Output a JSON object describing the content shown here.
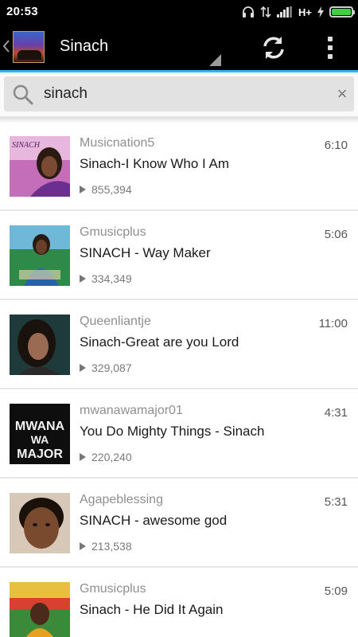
{
  "status_bar": {
    "time": "20:53",
    "network": "H+"
  },
  "action_bar": {
    "title": "Sinach"
  },
  "search": {
    "query": "sinach",
    "clear_glyph": "×"
  },
  "results": [
    {
      "channel": "Musicnation5",
      "title": "Sinach-I Know Who I Am",
      "duration": "6:10",
      "views": "855,394"
    },
    {
      "channel": "Gmusicplus",
      "title": "SINACH - Way Maker",
      "duration": "5:06",
      "views": "334,349"
    },
    {
      "channel": "Queenliantje",
      "title": "Sinach-Great are you Lord",
      "duration": "11:00",
      "views": "329,087"
    },
    {
      "channel": "mwanawamajor01",
      "title": "You Do Mighty Things - Sinach",
      "duration": "4:31",
      "views": "220,240"
    },
    {
      "channel": "Agapeblessing",
      "title": "SINACH - awesome god",
      "duration": "5:31",
      "views": "213,538"
    },
    {
      "channel": "Gmusicplus",
      "title": "Sinach - He Did It Again",
      "duration": "5:09",
      "views": ""
    }
  ],
  "thumb_text": {
    "sinach_logo": "SINACH",
    "mwana_line1": "MWANA",
    "mwana_line2": "WA",
    "mwana_line3": "MAJOR"
  },
  "colors": {
    "accent": "#33b5e5",
    "battery": "#3fcf3f"
  }
}
